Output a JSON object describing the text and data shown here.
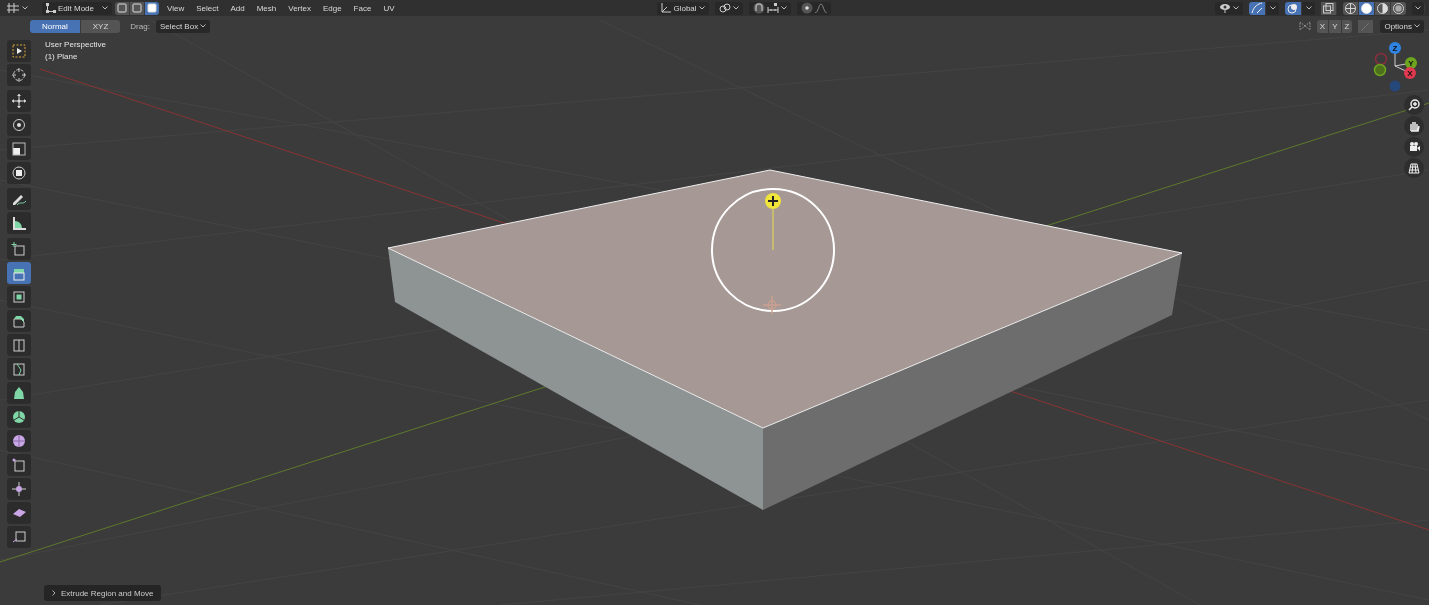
{
  "header": {
    "mode": "Edit Mode",
    "select_modes": [
      {
        "selected": false
      },
      {
        "selected": false
      },
      {
        "selected": true
      }
    ],
    "menus": [
      "View",
      "Select",
      "Add",
      "Mesh",
      "Vertex",
      "Edge",
      "Face",
      "UV"
    ],
    "transform_orientation": "Global",
    "proportional_edit": {
      "on": false
    },
    "gizmo_toggle": {
      "on": true
    },
    "overlay_toggle": {
      "on": true
    },
    "shading_modes": [
      {
        "selected": false
      },
      {
        "selected": true
      },
      {
        "selected": false
      },
      {
        "selected": false
      }
    ]
  },
  "tool_settings": {
    "orientation": [
      {
        "label": "Normal",
        "selected": true
      },
      {
        "label": "XYZ",
        "selected": false
      }
    ],
    "drag_label": "Drag:",
    "drag_value": "Select Box",
    "mirror_axes": [
      {
        "label": "X",
        "selected": false
      },
      {
        "label": "Y",
        "selected": false
      },
      {
        "label": "Z",
        "selected": false
      }
    ],
    "options": "Options"
  },
  "viewport": {
    "view_name": "User Perspective",
    "object_name": "(1) Plane"
  },
  "toolbar": [
    {
      "selected": false
    },
    {
      "selected": false
    },
    {
      "selected": false
    },
    {
      "selected": false
    },
    {
      "selected": false
    },
    {
      "selected": false
    },
    {
      "selected": false
    },
    {
      "selected": false
    },
    {
      "selected": false
    },
    {
      "selected": true
    },
    {
      "selected": false
    },
    {
      "selected": false
    },
    {
      "selected": false
    },
    {
      "selected": false
    },
    {
      "selected": false
    },
    {
      "selected": false
    },
    {
      "selected": false
    },
    {
      "selected": false
    },
    {
      "selected": false
    },
    {
      "selected": false
    },
    {
      "selected": false
    }
  ],
  "gizmo_axes": [
    "Z",
    "Y",
    "X"
  ],
  "last_operator": "Extrude Region and Move"
}
